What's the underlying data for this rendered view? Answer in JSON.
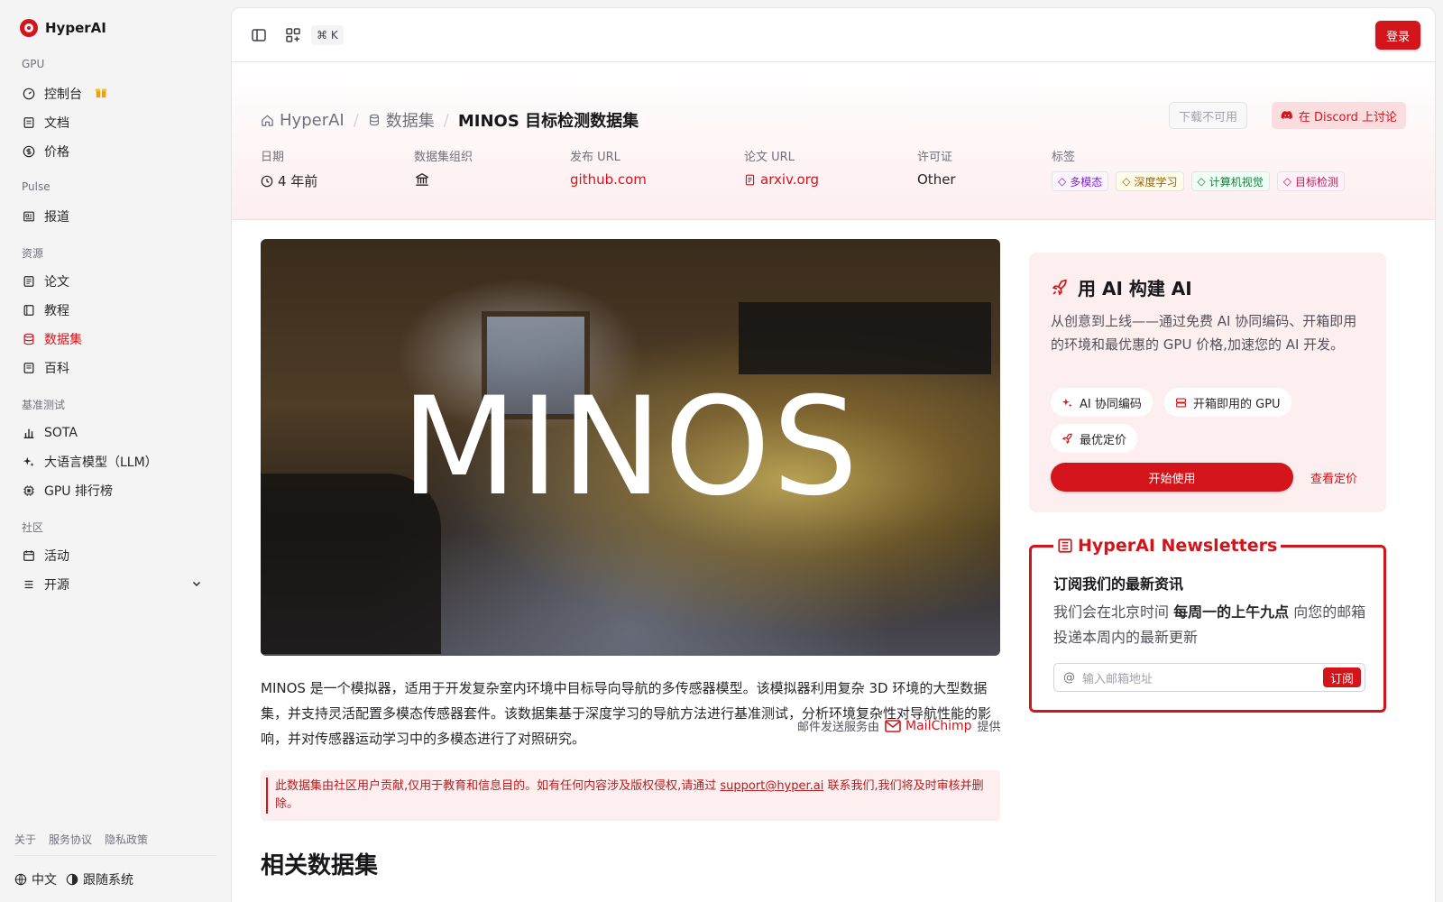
{
  "brand": {
    "name": "HyperAI"
  },
  "sidebar": {
    "sections": [
      {
        "title": "GPU",
        "items": [
          {
            "label": "控制台",
            "icon": "gauge-icon"
          },
          {
            "label": "文档",
            "icon": "book-icon"
          },
          {
            "label": "价格",
            "icon": "dollar-icon"
          }
        ]
      },
      {
        "title": "Pulse",
        "items": [
          {
            "label": "报道",
            "icon": "newspaper-icon"
          }
        ]
      },
      {
        "title": "资源",
        "items": [
          {
            "label": "论文",
            "icon": "paper-icon"
          },
          {
            "label": "教程",
            "icon": "tutorial-icon"
          },
          {
            "label": "数据集",
            "icon": "database-icon",
            "active": true
          },
          {
            "label": "百科",
            "icon": "encyclopedia-icon"
          }
        ]
      },
      {
        "title": "基准测试",
        "items": [
          {
            "label": "SOTA",
            "icon": "bar-chart-icon"
          },
          {
            "label": "大语言模型（LLM）",
            "icon": "sparkles-icon"
          },
          {
            "label": "GPU 排行榜",
            "icon": "chip-icon"
          }
        ]
      },
      {
        "title": "社区",
        "items": [
          {
            "label": "活动",
            "icon": "calendar-icon"
          },
          {
            "label": "开源",
            "icon": "list-icon"
          }
        ]
      }
    ],
    "footer_links": [
      "关于",
      "服务协议",
      "隐私政策"
    ],
    "language": "中文",
    "theme": "跟随系统"
  },
  "topbar": {
    "shortcut": "⌘ K",
    "login_label": "登录"
  },
  "breadcrumb": {
    "home": "HyperAI",
    "section": "数据集",
    "current": "MINOS 目标检测数据集"
  },
  "actions": {
    "download": "下载不可用",
    "discord": "在 Discord 上讨论"
  },
  "meta": {
    "date_label": "日期",
    "date_value": "4 年前",
    "org_label": "数据集组织",
    "url_label": "发布 URL",
    "url_value": "github.com",
    "paper_label": "论文 URL",
    "paper_value": "arxiv.org",
    "license_label": "许可证",
    "license_value": "Other",
    "tags_label": "标签",
    "tags": [
      {
        "label": "多模态",
        "color": "#7e22ce",
        "bg": "#faf5ff"
      },
      {
        "label": "深度学习",
        "color": "#a16207",
        "bg": "#fefce8"
      },
      {
        "label": "计算机视觉",
        "color": "#15803d",
        "bg": "#f0fdf4"
      },
      {
        "label": "目标检测",
        "color": "#be185d",
        "bg": "#fdf2f8"
      }
    ]
  },
  "hero": {
    "title": "MINOS"
  },
  "description": "MINOS 是一个模拟器，适用于开发复杂室内环境中目标导向导航的多传感器模型。该模拟器利用复杂 3D 环境的大型数据集，并支持灵活配置多模态传感器套件。该数据集基于深度学习的导航方法进行基准测试，分析环境复杂性对导航性能的影响，并对传感器运动学习中的多模态进行了对照研究。",
  "notice": {
    "before": "此数据集由社区用户贡献,仅用于教育和信息目的。如有任何内容涉及版权侵权,请通过 ",
    "email": "support@hyper.ai",
    "after": " 联系我们,我们将及时审核并删除。"
  },
  "related_title": "相关数据集",
  "promo": {
    "title": "用 AI 构建 AI",
    "desc": "从创意到上线——通过免费 AI 协同编码、开箱即用的环境和最优惠的 GPU 价格,加速您的 AI 开发。",
    "pills": [
      "AI 协同编码",
      "开箱即用的 GPU",
      "最优定价"
    ],
    "start": "开始使用",
    "pricing": "查看定价"
  },
  "newsletter": {
    "title": "HyperAI Newsletters",
    "heading": "订阅我们的最新资讯",
    "text_before": "我们会在北京时间 ",
    "text_bold": "每周一的上午九点",
    "text_after": " 向您的邮箱投递本周内的最新更新",
    "placeholder": "输入邮箱地址",
    "subscribe": "订阅",
    "by_before": "邮件发送服务由",
    "provider": "MailChimp",
    "by_after": "提供"
  },
  "colors": {
    "accent": "#d3151b",
    "accent_soft": "#fdeff0"
  }
}
